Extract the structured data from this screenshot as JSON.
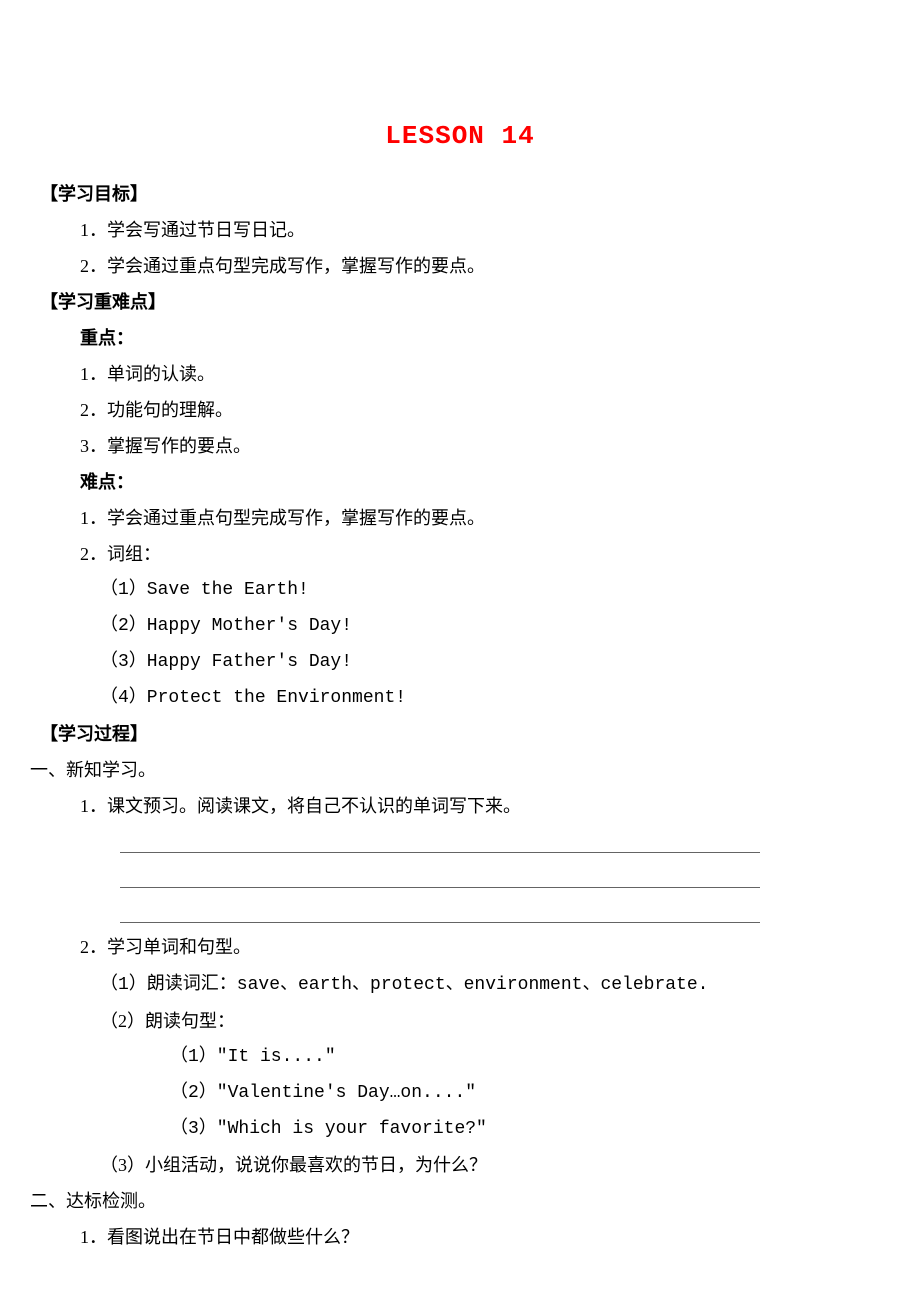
{
  "title": "LESSON 14",
  "goals_heading": "【学习目标】",
  "goals": [
    "1．学会写通过节日写日记。",
    "2．学会通过重点句型完成写作，掌握写作的要点。"
  ],
  "kd_heading": "【学习重难点】",
  "kd_key_label": "重点：",
  "kd_key": [
    "1．单词的认读。",
    "2．功能句的理解。",
    "3．掌握写作的要点。"
  ],
  "kd_diff_label": "难点：",
  "kd_diff": [
    "1．学会通过重点句型完成写作，掌握写作的要点。",
    "2．词组："
  ],
  "phrases": [
    "（1）Save the Earth!",
    "（2）Happy Mother's Day!",
    "（3）Happy Father's Day!",
    "（4）Protect the Environment!"
  ],
  "process_heading": "【学习过程】",
  "sec1_heading": "一、新知学习。",
  "sec1_item1": "1．课文预习。阅读课文，将自己不认识的单词写下来。",
  "sec1_item2": "2．学习单词和句型。",
  "sec1_sub1": "（1）朗读词汇：save、earth、protect、environment、celebrate.",
  "sec1_sub2": "（2）朗读句型：",
  "patterns": [
    "（1）\"It is....\"",
    "（2）\"Valentine's Day…on....\"",
    "（3）\"Which is your favorite?\""
  ],
  "sec1_sub3": "（3）小组活动，说说你最喜欢的节日，为什么？",
  "sec2_heading": "二、达标检测。",
  "sec2_item1": "1．看图说出在节日中都做些什么？"
}
